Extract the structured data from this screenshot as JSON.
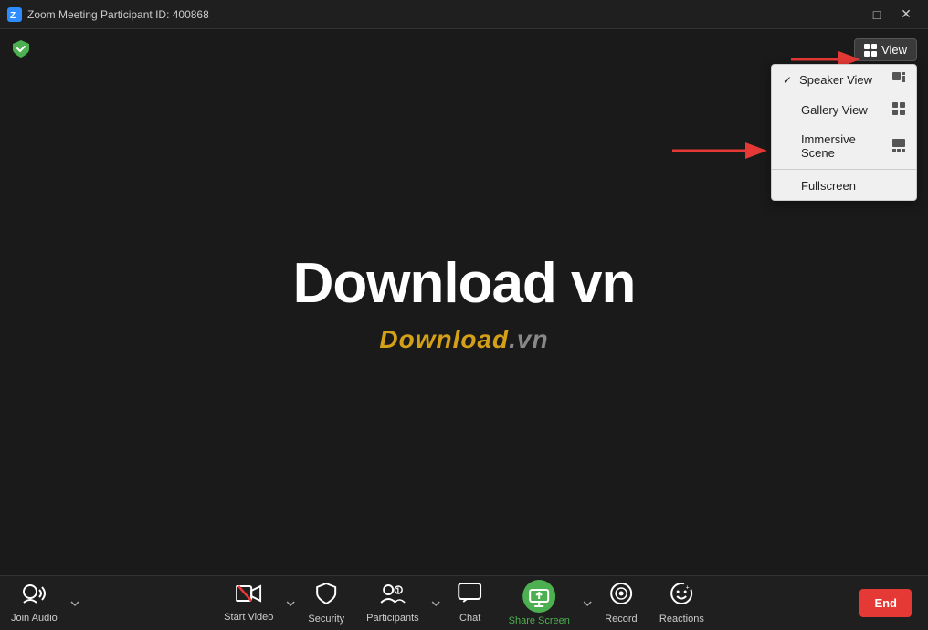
{
  "titlebar": {
    "title": "Zoom Meeting  Participant ID: 400868",
    "icon": "zoom",
    "controls": {
      "minimize": "–",
      "maximize": "□",
      "close": "✕"
    }
  },
  "header": {
    "view_button": "View",
    "shield_tooltip": "Security"
  },
  "dropdown": {
    "items": [
      {
        "label": "Speaker View",
        "checked": true,
        "icon": "grid"
      },
      {
        "label": "Gallery View",
        "checked": false,
        "icon": "grid4"
      },
      {
        "label": "Immersive Scene",
        "checked": false,
        "icon": "scene"
      }
    ],
    "separator": true,
    "fullscreen": "Fullscreen"
  },
  "main": {
    "big_title": "Download vn",
    "watermark": "Download.vn"
  },
  "toolbar": {
    "join_audio": "Join Audio",
    "start_video": "Start Video",
    "security": "Security",
    "participants": "Participants",
    "participants_count": "1",
    "chat": "Chat",
    "share_screen": "Share Screen",
    "record": "Record",
    "reactions": "Reactions",
    "end": "End"
  }
}
